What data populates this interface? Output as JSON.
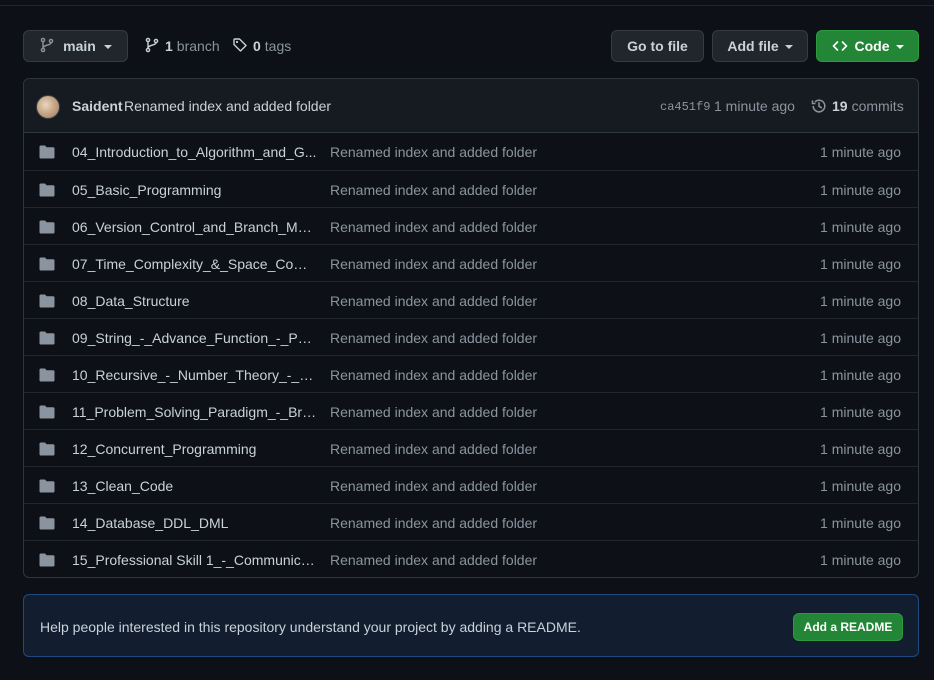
{
  "toolbar": {
    "branch_name": "main",
    "branch_count": "1",
    "branch_label": "branch",
    "tag_count": "0",
    "tag_label": "tags",
    "goto_file_label": "Go to file",
    "add_file_label": "Add file",
    "code_label": "Code"
  },
  "latest_commit": {
    "author": "Saident",
    "message": "Renamed index and added folder",
    "sha": "ca451f9",
    "time": "1 minute ago",
    "commit_count": "19",
    "commit_label": "commits"
  },
  "files": [
    {
      "name": "04_Introduction_to_Algorithm_and_G...",
      "message": "Renamed index and added folder",
      "time": "1 minute ago"
    },
    {
      "name": "05_Basic_Programming",
      "message": "Renamed index and added folder",
      "time": "1 minute ago"
    },
    {
      "name": "06_Version_Control_and_Branch_Man...",
      "message": "Renamed index and added folder",
      "time": "1 minute ago"
    },
    {
      "name": "07_Time_Complexity_&_Space_Comp...",
      "message": "Renamed index and added folder",
      "time": "1 minute ago"
    },
    {
      "name": "08_Data_Structure",
      "message": "Renamed index and added folder",
      "time": "1 minute ago"
    },
    {
      "name": "09_String_-_Advance_Function_-_Poin...",
      "message": "Renamed index and added folder",
      "time": "1 minute ago"
    },
    {
      "name": "10_Recursive_-_Number_Theory_-_So...",
      "message": "Renamed index and added folder",
      "time": "1 minute ago"
    },
    {
      "name": "11_Problem_Solving_Paradigm_-_Brut...",
      "message": "Renamed index and added folder",
      "time": "1 minute ago"
    },
    {
      "name": "12_Concurrent_Programming",
      "message": "Renamed index and added folder",
      "time": "1 minute ago"
    },
    {
      "name": "13_Clean_Code",
      "message": "Renamed index and added folder",
      "time": "1 minute ago"
    },
    {
      "name": "14_Database_DDL_DML",
      "message": "Renamed index and added folder",
      "time": "1 minute ago"
    },
    {
      "name": "15_Professional Skill 1_-_Communica...",
      "message": "Renamed index and added folder",
      "time": "1 minute ago"
    }
  ],
  "readme_banner": {
    "text": "Help people interested in this repository understand your project by adding a README.",
    "button_label": "Add a README"
  },
  "icons": {
    "branch": "git-branch-icon",
    "tag": "tag-icon",
    "folder": "folder-icon",
    "history": "history-icon",
    "code": "code-icon"
  },
  "colors": {
    "background": "#0d1117",
    "header_bg": "#161b22",
    "border": "#30363d",
    "primary_button": "#238636",
    "muted_text": "#8b949e",
    "folder_icon": "#8b949e",
    "readme_bg": "#121d2f",
    "readme_border": "#1f4a80"
  }
}
